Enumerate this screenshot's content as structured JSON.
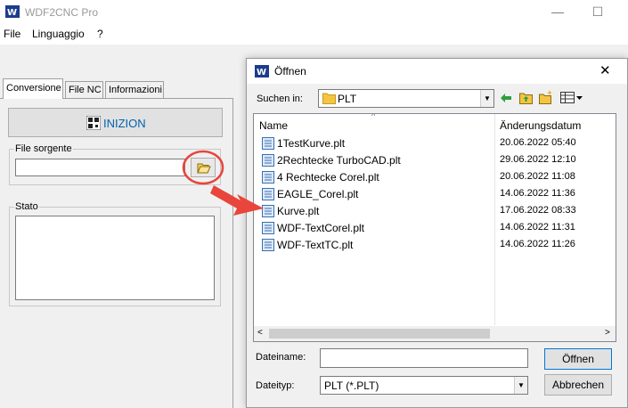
{
  "app": {
    "title": "WDF2CNC Pro",
    "menu": [
      "File",
      "Linguaggio",
      "?"
    ],
    "controls": {
      "minimize": "—",
      "maximize": "☐"
    }
  },
  "tabs": [
    "Conversione",
    "File NC",
    "Informazioni"
  ],
  "left": {
    "start_label": "INIZION",
    "source_label": "File sorgente",
    "source_value": "",
    "status_label": "Stato",
    "status_value": ""
  },
  "dialog": {
    "title": "Öffnen",
    "close_glyph": "✕",
    "look_in_label": "Suchen in:",
    "look_in_value": "PLT",
    "columns": {
      "name": "Name",
      "date": "Änderungsdatum"
    },
    "files": [
      {
        "name": "1TestKurve.plt",
        "date": "20.06.2022 05:40"
      },
      {
        "name": "2Rechtecke TurboCAD.plt",
        "date": "29.06.2022 12:10"
      },
      {
        "name": "4 Rechtecke Corel.plt",
        "date": "20.06.2022 11:08"
      },
      {
        "name": "EAGLE_Corel.plt",
        "date": "14.06.2022 11:36"
      },
      {
        "name": "Kurve.plt",
        "date": "17.06.2022 08:33"
      },
      {
        "name": "WDF-TextCorel.plt",
        "date": "14.06.2022 11:31"
      },
      {
        "name": "WDF-TextTC.plt",
        "date": "14.06.2022 11:26"
      }
    ],
    "filename_label": "Dateiname:",
    "filename_value": "",
    "filetype_label": "Dateityp:",
    "filetype_value": "PLT (*.PLT)",
    "open_label": "Öffnen",
    "cancel_label": "Abbrechen"
  },
  "colors": {
    "accent": "#0063b1",
    "annotation": "#e8453c",
    "folder": "#f4c542"
  }
}
